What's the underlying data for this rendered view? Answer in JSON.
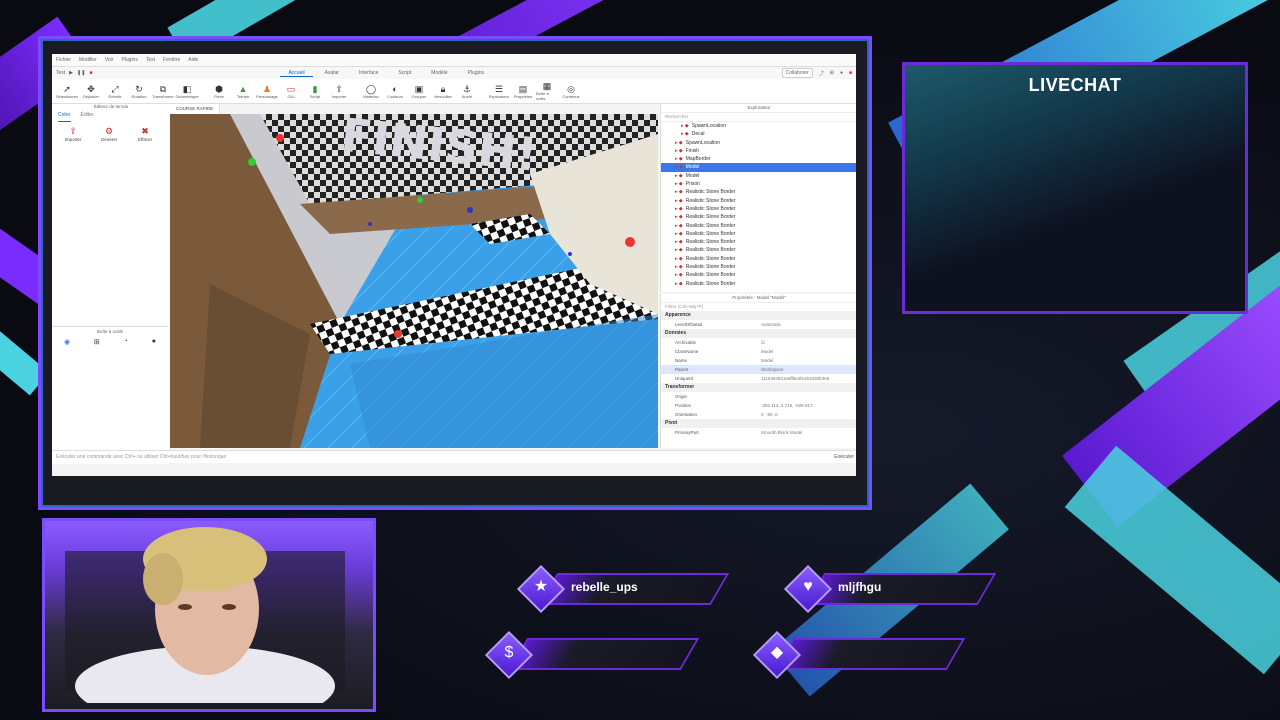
{
  "app": {
    "menu": [
      "Fichier",
      "Modifier",
      "Voir",
      "Plugins",
      "Test",
      "Fenêtre",
      "Aide"
    ],
    "quick": "Test",
    "tabs": [
      "Accueil",
      "Avatar",
      "Interface",
      "Script",
      "Modèle",
      "Plugins"
    ],
    "collab_label": "Collaborer",
    "tools": [
      "Sélectionner",
      "Déplacer",
      "Échelle",
      "Rotation",
      "Transformer",
      "Géométrique",
      "Pièce",
      "Terrain",
      "Personnage",
      "GUI",
      "Script",
      "Importer",
      "Matériau",
      "Couleurs",
      "Grouper",
      "Verrouiller",
      "Ancré",
      "Explorateur",
      "Propriétés",
      "Boîte à outils",
      "Contenus"
    ],
    "left_panel": {
      "title": "Éditeur de terrain",
      "tabs": [
        "Créer",
        "Éditer"
      ],
      "tools": [
        "Importer",
        "Générer",
        "Effacer"
      ],
      "asset_title": "Boîte à outils"
    },
    "viewport_tab": "COURSE RAPIDE",
    "command_placeholder": "Exécuter une commande avec Ctrl+ ou utiliser Ctrl+haut/bas pour l'historique",
    "command_run": "Exécuter",
    "explorer": {
      "title": "Explorateur",
      "search": "Rechercher",
      "items": [
        {
          "label": "SpawnLocation",
          "indent": true
        },
        {
          "label": "Decal",
          "indent": true
        },
        {
          "label": "SpawnLocation",
          "indent": false
        },
        {
          "label": "Finish",
          "indent": false
        },
        {
          "label": "MapBorder",
          "indent": false
        },
        {
          "label": "Model",
          "indent": false,
          "selected": true
        },
        {
          "label": "Model",
          "indent": false
        },
        {
          "label": "Prison",
          "indent": false
        },
        {
          "label": "Realistic Stone Border",
          "indent": false
        },
        {
          "label": "Realistic Stone Border",
          "indent": false
        },
        {
          "label": "Realistic Stone Border",
          "indent": false
        },
        {
          "label": "Realistic Stone Border",
          "indent": false
        },
        {
          "label": "Realistic Stone Border",
          "indent": false
        },
        {
          "label": "Realistic Stone Border",
          "indent": false
        },
        {
          "label": "Realistic Stone Border",
          "indent": false
        },
        {
          "label": "Realistic Stone Border",
          "indent": false
        },
        {
          "label": "Realistic Stone Border",
          "indent": false
        },
        {
          "label": "Realistic Stone Border",
          "indent": false
        },
        {
          "label": "Realistic Stone Border",
          "indent": false
        },
        {
          "label": "Realistic Stone Border",
          "indent": false
        }
      ]
    },
    "properties": {
      "title": "Propriétés - Model \"Model\"",
      "filter": "Filtrer (Ctrl+Maj+P)",
      "sections": [
        {
          "name": "Apparence",
          "rows": [
            {
              "k": "LevelOfDetail",
              "v": "Automatic"
            }
          ]
        },
        {
          "name": "Données",
          "rows": [
            {
              "k": "Archivable",
              "v": "☑"
            },
            {
              "k": "ClassName",
              "v": "Model"
            },
            {
              "k": "Name",
              "v": "Model"
            },
            {
              "k": "Parent",
              "v": "Workspace",
              "hl": true
            },
            {
              "k": "UniqueId",
              "v": "1116494931e6ff5e4fe1b1000b3e5"
            }
          ]
        },
        {
          "name": "Transformer",
          "rows": [
            {
              "k": "Origin",
              "v": ""
            },
            {
              "k": "Position",
              "v": "-282.114, 2.715, -626.917"
            },
            {
              "k": "Orientation",
              "v": "0, -90, 0"
            }
          ]
        },
        {
          "name": "Pivot",
          "rows": [
            {
              "k": "PrimaryPart",
              "v": "Smooth Block Model"
            }
          ]
        }
      ]
    }
  },
  "chat": {
    "title": "LIVECHAT"
  },
  "labels": [
    {
      "name": "rebelle_ups",
      "icon": "★"
    },
    {
      "name": "mljfhgu",
      "icon": "♥"
    },
    {
      "name": "",
      "icon": "$"
    },
    {
      "name": "",
      "icon": "◆"
    }
  ],
  "scene": {
    "finish_text": "FINISH!"
  }
}
